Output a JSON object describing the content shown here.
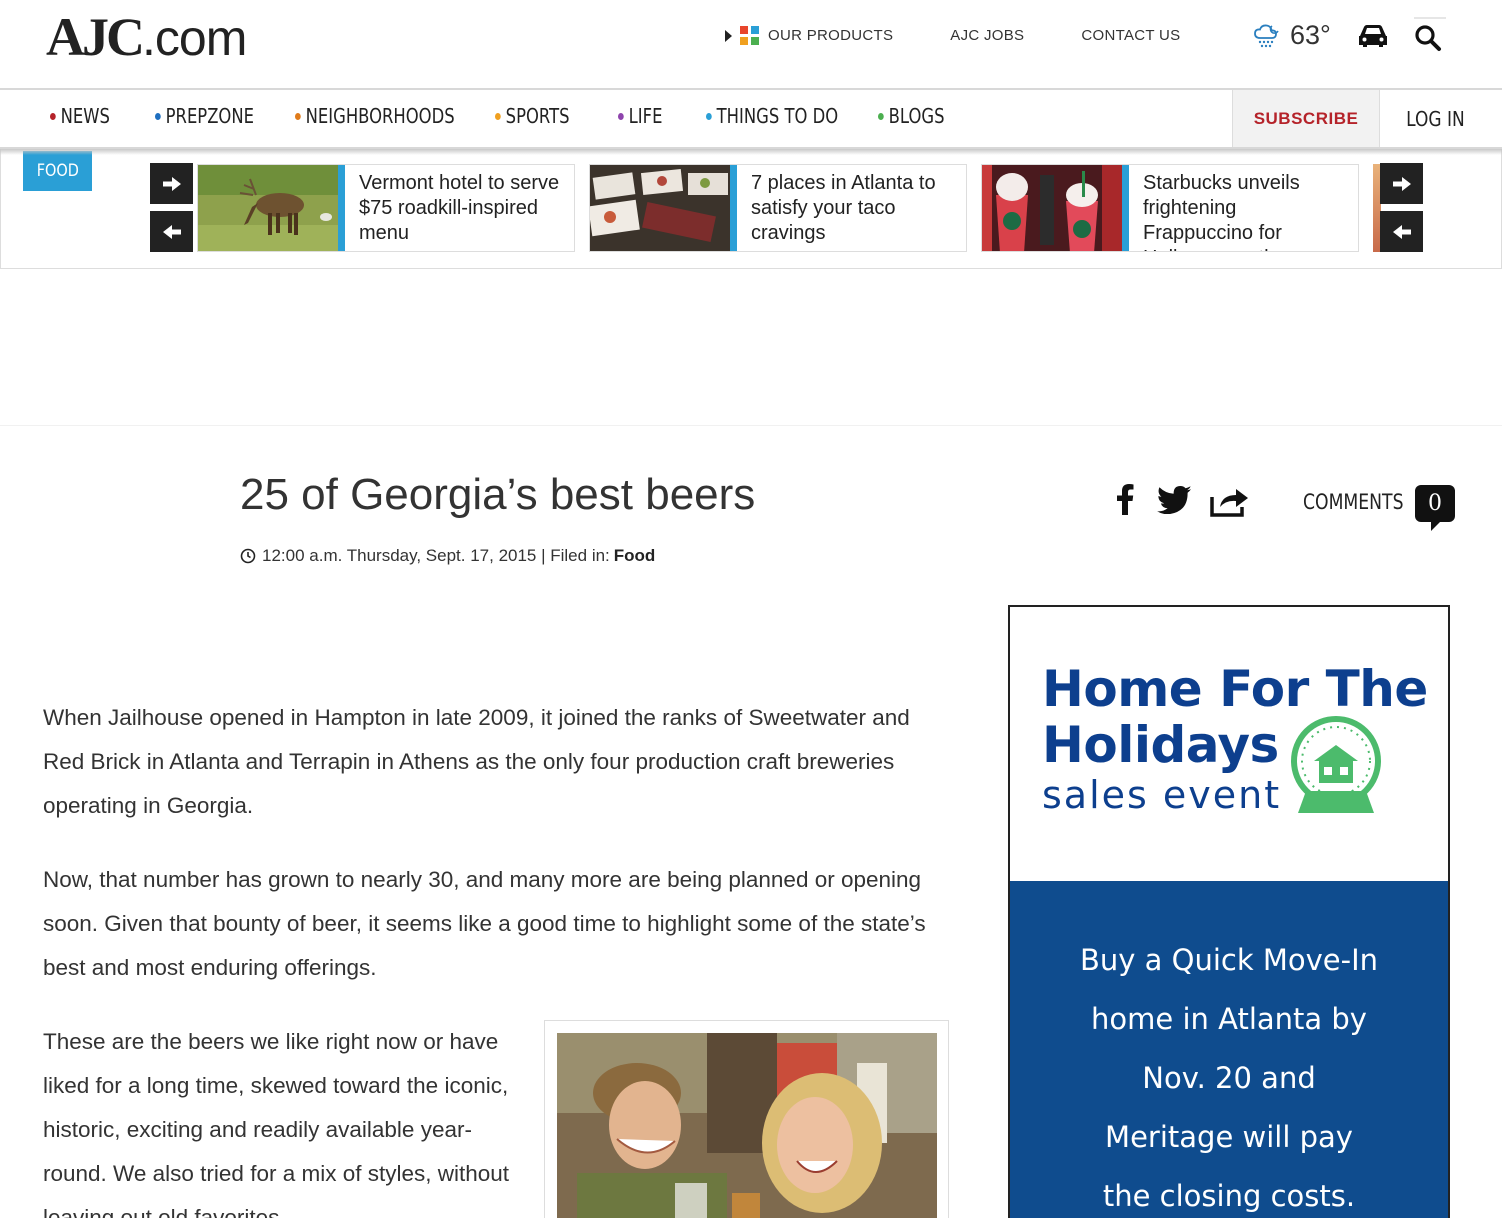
{
  "header": {
    "logo_main": "AJC",
    "logo_suffix": ".com",
    "links": [
      "OUR PRODUCTS",
      "AJC JOBS",
      "CONTACT US"
    ],
    "product_colors": [
      "#e8452c",
      "#2a9fd6",
      "#f0a020",
      "#4caf50"
    ],
    "temperature": "63°",
    "weather_icon": "rain-cloud-icon",
    "car_icon": "car-icon",
    "search_icon": "search-icon"
  },
  "nav": {
    "items": [
      {
        "label": "NEWS",
        "color": "#b5232a"
      },
      {
        "label": "PREPZONE",
        "color": "#1f6fc0"
      },
      {
        "label": "NEIGHBORHOODS",
        "color": "#e07b1a"
      },
      {
        "label": "SPORTS",
        "color": "#f0a020"
      },
      {
        "label": "LIFE",
        "color": "#8e44ad"
      },
      {
        "label": "THINGS TO DO",
        "color": "#2a9fd6"
      },
      {
        "label": "BLOGS",
        "color": "#4caf50"
      }
    ],
    "subscribe": "SUBSCRIBE",
    "login": "LOG IN"
  },
  "strip": {
    "tag": "FOOD",
    "cards": [
      {
        "title": "Vermont hotel to serve $75 roadkill-inspired menu"
      },
      {
        "title": "7 places in Atlanta to satisfy your taco cravings"
      },
      {
        "title": "Starbucks unveils frightening Frappuccino for Halloween – the"
      }
    ]
  },
  "article": {
    "headline": "25 of Georgia’s best beers",
    "timestamp": "12:00 a.m. Thursday, Sept. 17, 2015 | Filed in:",
    "category": "Food",
    "comments_label": "COMMENTS",
    "comments_count": "0",
    "paragraphs": [
      "When Jailhouse opened in Hampton in late 2009, it joined the ranks of Sweetwater and Red Brick in Atlanta and Terrapin in Athens as the only four production craft breweries operating in Georgia.",
      "Now, that number has grown to nearly 30, and many more are being planned or opening soon. Given that bounty of beer, it seems like a good time to highlight some of the state’s best and most enduring offerings.",
      "These are the beers we like right now or have liked for a long time, skewed toward the iconic, historic, exciting and readily available year-round. We also tried for a mix of styles, without leaving out old favorites"
    ]
  },
  "ad": {
    "headline_line1": "Home For The",
    "headline_line2": "Holidays",
    "subheadline": "sales event",
    "body_lines": [
      "Buy a Quick Move-In",
      "home in Atlanta by",
      "Nov. 20 and",
      "Meritage will pay",
      "the closing costs."
    ],
    "brand_color": "#0d3f8e",
    "accent_color": "#4cbb6c"
  }
}
